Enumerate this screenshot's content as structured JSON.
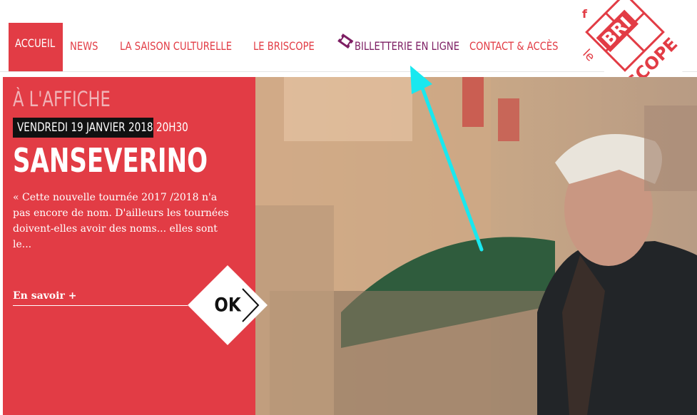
{
  "nav": {
    "home_label": "ACCUEIL",
    "items": [
      {
        "label": "NEWS"
      },
      {
        "label": "LA SAISON CULTURELLE"
      },
      {
        "label": "LE BRISCOPE"
      },
      {
        "label": "BILLETTERIE EN LIGNE"
      },
      {
        "label": "CONTACT & ACCÈS"
      }
    ],
    "ticket_icon": "ticket-icon"
  },
  "social": {
    "facebook_glyph": "f",
    "icon": "facebook-icon"
  },
  "logo": {
    "le": "le",
    "bri": "BRI",
    "scope": "SCOPE"
  },
  "colors": {
    "brand_red": "#e23c45",
    "ticket_purple": "#7d1e63",
    "annotation_cyan": "#19e8ef"
  },
  "feature": {
    "kicker": "À L'AFFICHE",
    "date": "VENDREDI 19 JANVIER 2018",
    "time": "20H30",
    "title": "SANSEVERINO",
    "excerpt_lines": [
      "« Cette nouvelle tournée 2017 /2018 n'a",
      "pas encore de nom. D'ailleurs les tournées",
      "doivent-elles avoir des noms... elles sont",
      "le..."
    ],
    "read_more": "En savoir +",
    "ok_button": "OK"
  }
}
